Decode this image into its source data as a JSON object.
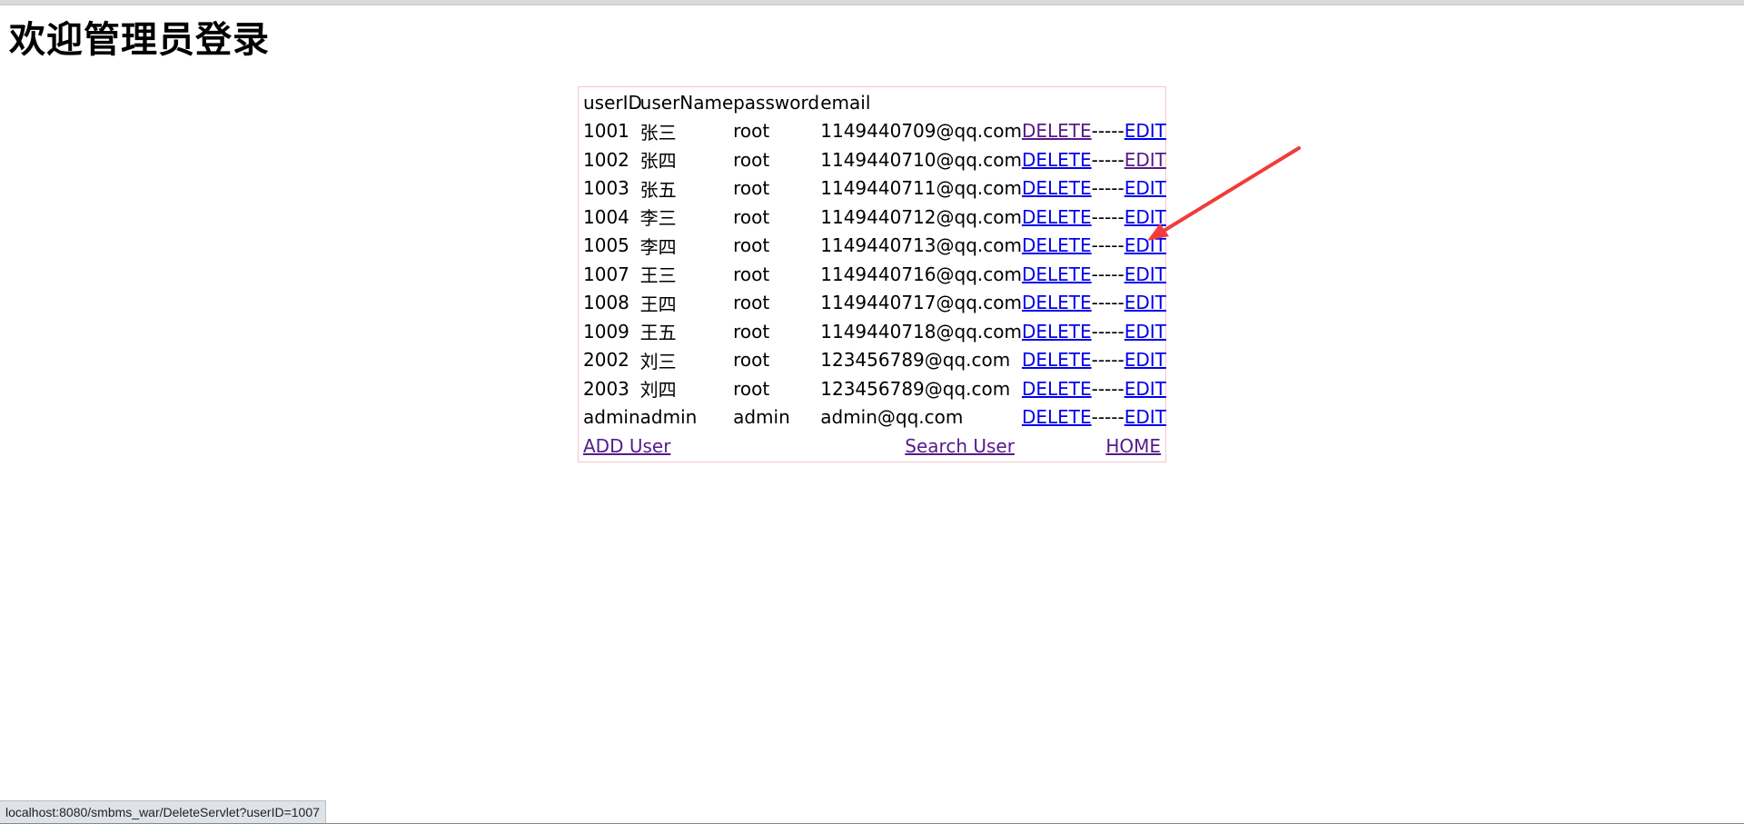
{
  "page": {
    "title": "欢迎管理员登录"
  },
  "table": {
    "headers": [
      "userID",
      "userName",
      "password",
      "email"
    ],
    "rows": [
      {
        "userID": "1001",
        "userName": "张三",
        "password": "root",
        "email": "1149440709@qq.com",
        "delete_label": "DELETE",
        "sep": "-----",
        "edit_label": "EDIT",
        "delete_visited": true,
        "edit_visited": false
      },
      {
        "userID": "1002",
        "userName": "张四",
        "password": "root",
        "email": "1149440710@qq.com",
        "delete_label": "DELETE",
        "sep": "-----",
        "edit_label": "EDIT",
        "delete_visited": false,
        "edit_visited": true
      },
      {
        "userID": "1003",
        "userName": "张五",
        "password": "root",
        "email": "1149440711@qq.com",
        "delete_label": "DELETE",
        "sep": "-----",
        "edit_label": "EDIT",
        "delete_visited": false,
        "edit_visited": false
      },
      {
        "userID": "1004",
        "userName": "李三",
        "password": "root",
        "email": "1149440712@qq.com",
        "delete_label": "DELETE",
        "sep": "-----",
        "edit_label": "EDIT",
        "delete_visited": false,
        "edit_visited": false
      },
      {
        "userID": "1005",
        "userName": "李四",
        "password": "root",
        "email": "1149440713@qq.com",
        "delete_label": "DELETE",
        "sep": "-----",
        "edit_label": "EDIT",
        "delete_visited": false,
        "edit_visited": false
      },
      {
        "userID": "1007",
        "userName": "王三",
        "password": "root",
        "email": "1149440716@qq.com",
        "delete_label": "DELETE",
        "sep": "-----",
        "edit_label": "EDIT",
        "delete_visited": false,
        "edit_visited": false
      },
      {
        "userID": "1008",
        "userName": "王四",
        "password": "root",
        "email": "1149440717@qq.com",
        "delete_label": "DELETE",
        "sep": "-----",
        "edit_label": "EDIT",
        "delete_visited": false,
        "edit_visited": false
      },
      {
        "userID": "1009",
        "userName": "王五",
        "password": "root",
        "email": "1149440718@qq.com",
        "delete_label": "DELETE",
        "sep": "-----",
        "edit_label": "EDIT",
        "delete_visited": false,
        "edit_visited": false
      },
      {
        "userID": "2002",
        "userName": "刘三",
        "password": "root",
        "email": "123456789@qq.com",
        "delete_label": "DELETE",
        "sep": "-----",
        "edit_label": "EDIT",
        "delete_visited": false,
        "edit_visited": false
      },
      {
        "userID": "2003",
        "userName": "刘四",
        "password": "root",
        "email": "123456789@qq.com",
        "delete_label": "DELETE",
        "sep": "-----",
        "edit_label": "EDIT",
        "delete_visited": false,
        "edit_visited": false
      },
      {
        "userID": "admin",
        "userName": "admin",
        "password": "admin",
        "email": "admin@qq.com",
        "delete_label": "DELETE",
        "sep": "-----",
        "edit_label": "EDIT",
        "delete_visited": false,
        "edit_visited": false
      }
    ],
    "footer": {
      "add_user": "ADD User",
      "search_user": "Search User",
      "home": "HOME"
    }
  },
  "annotation": {
    "arrow_color": "#f03c3c",
    "icon": "arrow-icon"
  },
  "status_bar": {
    "url": "localhost:8080/smbms_war/DeleteServlet?userID=1007"
  },
  "colors": {
    "link": "#0000ee",
    "visited_link": "#551a8b",
    "table_border": "#f3c6d4"
  }
}
